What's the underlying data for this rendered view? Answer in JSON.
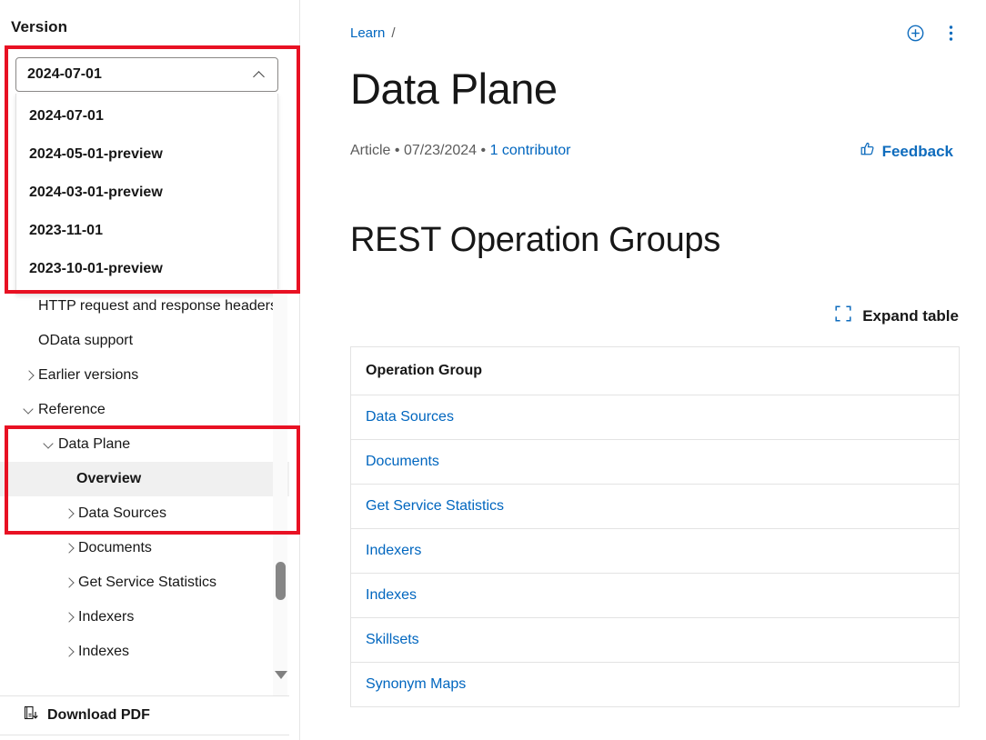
{
  "sidebar": {
    "version_label": "Version",
    "version_select": {
      "value": "2024-07-01",
      "expanded": true,
      "chevron_icon": "chevron-up-icon",
      "options": [
        "2024-07-01",
        "2024-05-01-preview",
        "2024-03-01-preview",
        "2023-11-01",
        "2023-10-01-preview"
      ]
    },
    "nav_items": [
      {
        "label": "HTTP request and response headers",
        "indent": "lvl1",
        "caret": "none",
        "active": false
      },
      {
        "label": "OData support",
        "indent": "lvl1",
        "caret": "none",
        "active": false
      },
      {
        "label": "Earlier versions",
        "indent": "lvl1c",
        "caret": "right",
        "active": false
      },
      {
        "label": "Reference",
        "indent": "lvl1c",
        "caret": "down",
        "active": false
      },
      {
        "label": "Data Plane",
        "indent": "lvl2c",
        "caret": "down",
        "active": false
      },
      {
        "label": "Overview",
        "indent": "lvl3",
        "caret": "none",
        "active": true
      },
      {
        "label": "Data Sources",
        "indent": "lvl3c",
        "caret": "right",
        "active": false
      },
      {
        "label": "Documents",
        "indent": "lvl3c",
        "caret": "right",
        "active": false
      },
      {
        "label": "Get Service Statistics",
        "indent": "lvl3c",
        "caret": "right",
        "active": false
      },
      {
        "label": "Indexers",
        "indent": "lvl3c",
        "caret": "right",
        "active": false
      },
      {
        "label": "Indexes",
        "indent": "lvl3c",
        "caret": "right",
        "active": false
      }
    ],
    "download_pdf_label": "Download PDF",
    "download_pdf_icon": "book-download-icon"
  },
  "main": {
    "breadcrumb": {
      "root": "Learn",
      "separator": "/"
    },
    "top_actions": [
      {
        "name": "add-to-collection-icon",
        "label": "Add"
      },
      {
        "name": "more-options-icon",
        "label": "More"
      }
    ],
    "page_title": "Data Plane",
    "meta": {
      "type": "Article",
      "bullet": "•",
      "date": "07/23/2024",
      "contributors": "1 contributor"
    },
    "feedback": {
      "label": "Feedback",
      "icon": "thumbs-up-icon"
    },
    "section_title": "REST Operation Groups",
    "expand_table": {
      "label": "Expand table",
      "icon": "expand-icon"
    },
    "table": {
      "columns": [
        "Operation Group"
      ],
      "rows": [
        "Data Sources",
        "Documents",
        "Get Service Statistics",
        "Indexers",
        "Indexes",
        "Skillsets",
        "Synonym Maps"
      ]
    }
  },
  "annotations": [
    {
      "name": "version-dropdown-highlight",
      "color": "#e81123"
    },
    {
      "name": "reference-section-highlight",
      "color": "#e81123"
    }
  ],
  "colors": {
    "link": "#0066bf",
    "accent": "#0f6cbd",
    "annotation": "#e81123",
    "text": "#171717",
    "muted": "#5c5c5c"
  }
}
